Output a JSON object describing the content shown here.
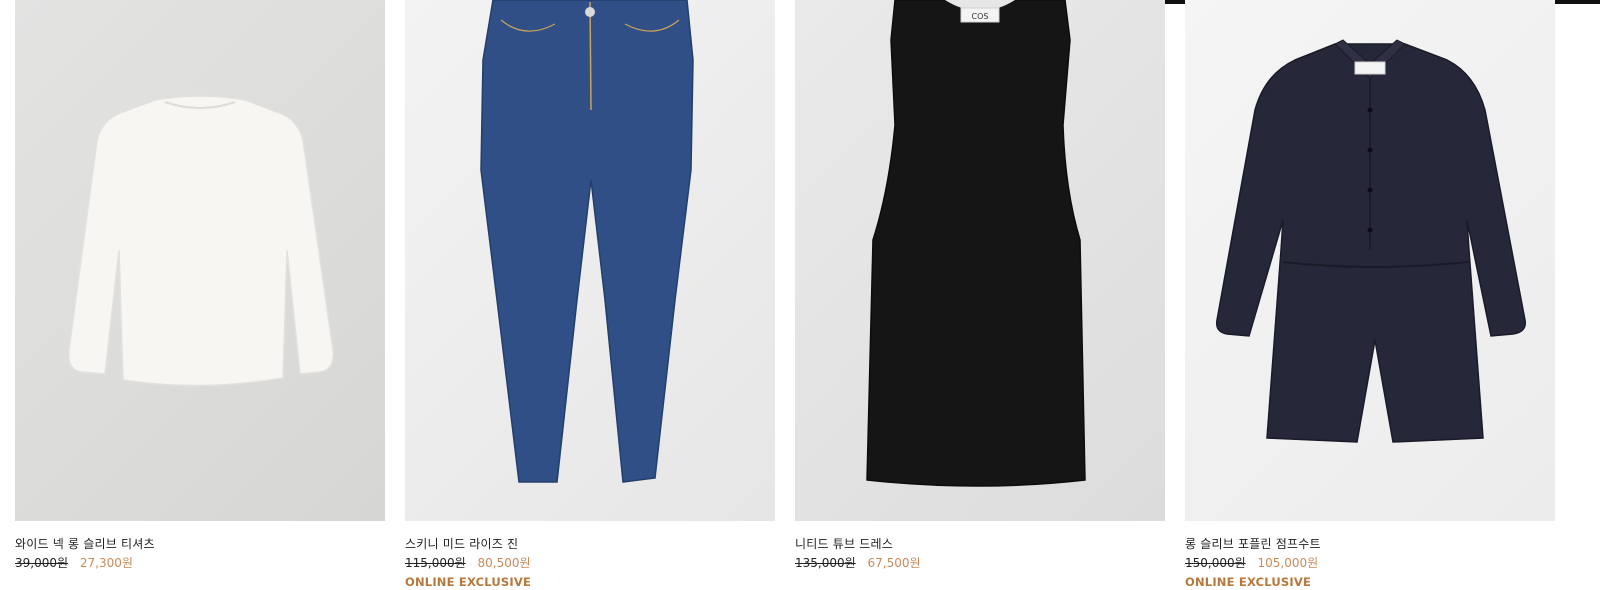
{
  "products": [
    {
      "name": "와이드 넥 롱 슬리브 티셔츠",
      "original_price": "39,000원",
      "sale_price": "27,300원",
      "tag": "",
      "image": "white-long-sleeve-tshirt"
    },
    {
      "name": "스키니 미드 라이즈 진",
      "original_price": "115,000원",
      "sale_price": "80,500원",
      "tag": "ONLINE EXCLUSIVE",
      "image": "blue-skinny-jeans"
    },
    {
      "name": "니티드 튜브 드레스",
      "original_price": "135,000원",
      "sale_price": "67,500원",
      "tag": "",
      "image": "black-knitted-dress"
    },
    {
      "name": "롱 슬리브 포플린 점프수트",
      "original_price": "150,000원",
      "sale_price": "105,000원",
      "tag": "ONLINE EXCLUSIVE",
      "image": "navy-poplin-jumpsuit"
    }
  ],
  "labels": {
    "garment_brand": "COS"
  },
  "colors": {
    "sale_price": "#c98b5b",
    "online_exclusive": "#b6783b",
    "text": "#222222"
  }
}
